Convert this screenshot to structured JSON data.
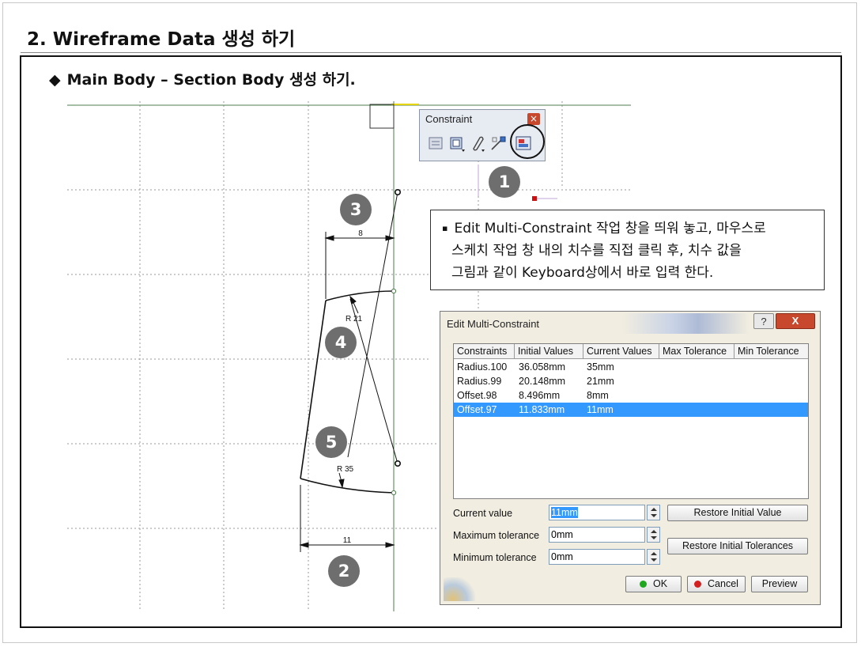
{
  "slide": {
    "title": "2. Wireframe Data 생성 하기",
    "section": {
      "bullet": "◆",
      "text": "Main Body – Section Body 생성 하기."
    }
  },
  "sketch": {
    "dimension_labels": {
      "top_width": "8",
      "upper_radius": "R 21",
      "lower_radius": "R 35",
      "bottom_width": "11"
    },
    "callouts": [
      "1",
      "2",
      "3",
      "4",
      "5"
    ]
  },
  "constraint_toolbar": {
    "title": "Constraint",
    "close_glyph": "×",
    "icons": [
      "constraint-dialog-icon",
      "contact-constraint-icon",
      "fix-together-icon",
      "animate-constraint-icon",
      "edit-multi-constraint-icon"
    ]
  },
  "note": {
    "bullet": "▪",
    "line1": "Edit Multi-Constraint 작업 창을 띄워 놓고, 마우스로",
    "line2": "스케치 작업 창 내의 치수를 직접 클릭 후, 치수 값을",
    "line3": "그림과 같이 Keyboard상에서 바로 입력 한다."
  },
  "dialog": {
    "title": "Edit Multi-Constraint",
    "help_glyph": "?",
    "close_glyph": "X",
    "columns": [
      "Constraints",
      "Initial Values",
      "Current Values",
      "Max Tolerance",
      "Min Tolerance"
    ],
    "rows": [
      {
        "name": "Radius.100",
        "initial": "36.058mm",
        "current": "35mm",
        "selected": false
      },
      {
        "name": "Radius.99",
        "initial": "20.148mm",
        "current": "21mm",
        "selected": false
      },
      {
        "name": "Offset.98",
        "initial": "8.496mm",
        "current": "8mm",
        "selected": false
      },
      {
        "name": "Offset.97",
        "initial": "11.833mm",
        "current": "11mm",
        "selected": true
      }
    ],
    "fields": {
      "current_value_label": "Current value",
      "current_value": "11mm",
      "max_tol_label": "Maximum tolerance",
      "max_tol_value": "0mm",
      "min_tol_label": "Minimum tolerance",
      "min_tol_value": "0mm"
    },
    "buttons": {
      "restore_value": "Restore Initial Value",
      "restore_tolerances": "Restore Initial Tolerances",
      "ok": "OK",
      "cancel": "Cancel",
      "preview": "Preview"
    },
    "colors": {
      "ok_dot": "#1fa81f",
      "cancel_dot": "#d42020",
      "selection": "#3399ff"
    }
  }
}
